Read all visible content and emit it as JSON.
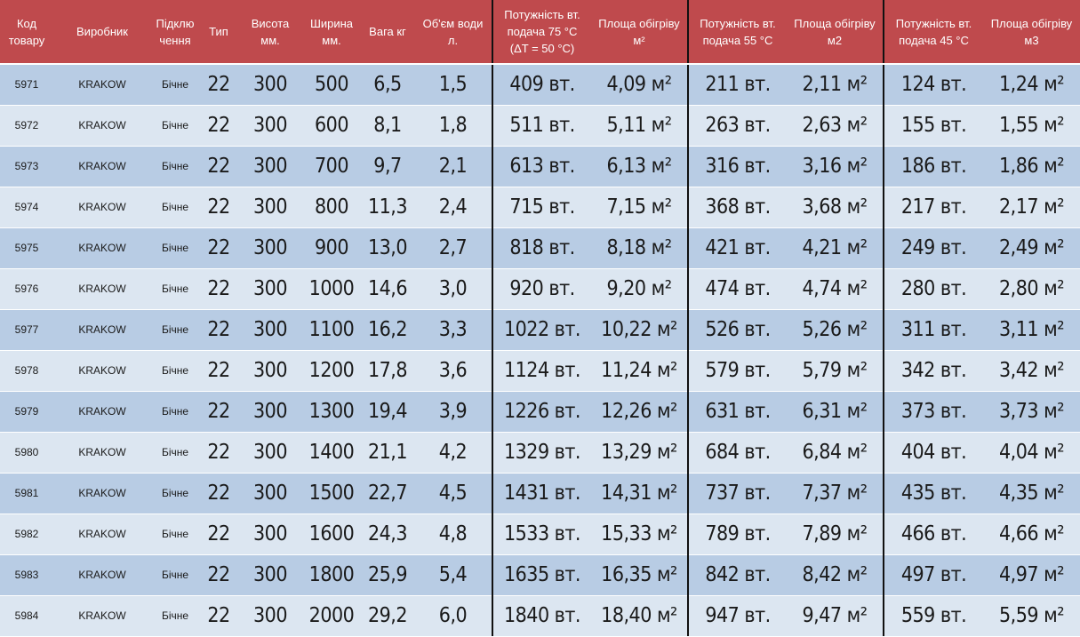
{
  "headers": [
    "Код\nтовару",
    "Виробник",
    "Підклю\nчення",
    "Тип",
    "Висота\nмм.",
    "Ширина\nмм.",
    "Вага кг",
    "Об'єм води\nл.",
    "Потужність вт.\nподача 75 °С\n(ΔT = 50 °С)",
    "Площа обігріву\nм²",
    "Потужність вт.\nподача 55 °С",
    "Площа обігріву\nм2",
    "Потужність вт.\nподача 45 °С",
    "Площа обігріву\nм3"
  ],
  "rows": [
    [
      "5971",
      "KRAKOW",
      "Бічне",
      "22",
      "300",
      "500",
      "6,5",
      "1,5",
      "409 вт.",
      "4,09 м²",
      "211 вт.",
      "2,11 м²",
      "124 вт.",
      "1,24 м²"
    ],
    [
      "5972",
      "KRAKOW",
      "Бічне",
      "22",
      "300",
      "600",
      "8,1",
      "1,8",
      "511 вт.",
      "5,11 м²",
      "263 вт.",
      "2,63 м²",
      "155 вт.",
      "1,55 м²"
    ],
    [
      "5973",
      "KRAKOW",
      "Бічне",
      "22",
      "300",
      "700",
      "9,7",
      "2,1",
      "613 вт.",
      "6,13 м²",
      "316 вт.",
      "3,16 м²",
      "186 вт.",
      "1,86 м²"
    ],
    [
      "5974",
      "KRAKOW",
      "Бічне",
      "22",
      "300",
      "800",
      "11,3",
      "2,4",
      "715 вт.",
      "7,15 м²",
      "368 вт.",
      "3,68 м²",
      "217 вт.",
      "2,17 м²"
    ],
    [
      "5975",
      "KRAKOW",
      "Бічне",
      "22",
      "300",
      "900",
      "13,0",
      "2,7",
      "818 вт.",
      "8,18 м²",
      "421 вт.",
      "4,21 м²",
      "249 вт.",
      "2,49 м²"
    ],
    [
      "5976",
      "KRAKOW",
      "Бічне",
      "22",
      "300",
      "1000",
      "14,6",
      "3,0",
      "920 вт.",
      "9,20 м²",
      "474 вт.",
      "4,74 м²",
      "280 вт.",
      "2,80 м²"
    ],
    [
      "5977",
      "KRAKOW",
      "Бічне",
      "22",
      "300",
      "1100",
      "16,2",
      "3,3",
      "1022 вт.",
      "10,22 м²",
      "526 вт.",
      "5,26 м²",
      "311 вт.",
      "3,11 м²"
    ],
    [
      "5978",
      "KRAKOW",
      "Бічне",
      "22",
      "300",
      "1200",
      "17,8",
      "3,6",
      "1124 вт.",
      "11,24 м²",
      "579 вт.",
      "5,79 м²",
      "342 вт.",
      "3,42 м²"
    ],
    [
      "5979",
      "KRAKOW",
      "Бічне",
      "22",
      "300",
      "1300",
      "19,4",
      "3,9",
      "1226 вт.",
      "12,26 м²",
      "631 вт.",
      "6,31 м²",
      "373 вт.",
      "3,73 м²"
    ],
    [
      "5980",
      "KRAKOW",
      "Бічне",
      "22",
      "300",
      "1400",
      "21,1",
      "4,2",
      "1329 вт.",
      "13,29 м²",
      "684 вт.",
      "6,84 м²",
      "404 вт.",
      "4,04 м²"
    ],
    [
      "5981",
      "KRAKOW",
      "Бічне",
      "22",
      "300",
      "1500",
      "22,7",
      "4,5",
      "1431 вт.",
      "14,31 м²",
      "737 вт.",
      "7,37 м²",
      "435 вт.",
      "4,35 м²"
    ],
    [
      "5982",
      "KRAKOW",
      "Бічне",
      "22",
      "300",
      "1600",
      "24,3",
      "4,8",
      "1533 вт.",
      "15,33 м²",
      "789 вт.",
      "7,89 м²",
      "466 вт.",
      "4,66 м²"
    ],
    [
      "5983",
      "KRAKOW",
      "Бічне",
      "22",
      "300",
      "1800",
      "25,9",
      "5,4",
      "1635 вт.",
      "16,35 м²",
      "842 вт.",
      "8,42 м²",
      "497 вт.",
      "4,97 м²"
    ],
    [
      "5984",
      "KRAKOW",
      "Бічне",
      "22",
      "300",
      "2000",
      "29,2",
      "6,0",
      "1840 вт.",
      "18,40 м²",
      "947 вт.",
      "9,47 м²",
      "559 вт.",
      "5,59 м²"
    ]
  ],
  "colors": {
    "header_bg": "#bf4a4d",
    "row_dark": "#b8cce4",
    "row_light": "#dce6f1",
    "separator": "#111111"
  }
}
